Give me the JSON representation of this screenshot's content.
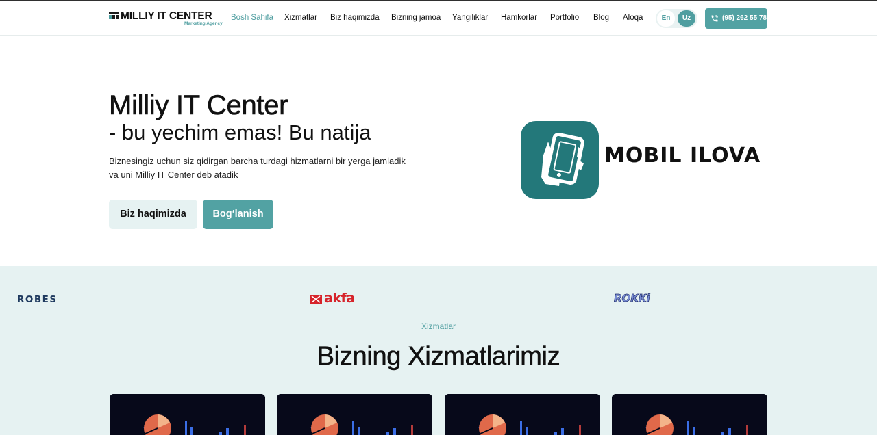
{
  "header": {
    "logo_text": "MILLIY IT CENTER",
    "logo_subtitle": "Marketing Agency",
    "nav": [
      {
        "label": "Bosh Sahifa",
        "active": true
      },
      {
        "label": "Xizmatlar"
      },
      {
        "label": "Biz haqimizda"
      },
      {
        "label": "Bizning jamoa"
      },
      {
        "label": "Yangiliklar"
      },
      {
        "label": "Hamkorlar"
      },
      {
        "label": "Portfolio"
      },
      {
        "label": "Blog"
      },
      {
        "label": "Aloqa"
      }
    ],
    "lang": {
      "en": "En",
      "uz": "Uz",
      "selected": "Uz"
    },
    "phone": "(95) 262 55 78"
  },
  "hero": {
    "title": "Milliy IT Center",
    "subtitle": "- bu yechim emas! Bu natija",
    "description_line1": "Biznesingiz uchun siz qidirgan barcha turdagi hizmatlarni bir yerga jamladik",
    "description_line2": "va uni Milliy IT Center deb atadik",
    "about_button": "Biz haqimizda",
    "contact_button": "Bog‘lanish",
    "banner_text": "MOBIL ILOVA"
  },
  "partners": [
    "ROBES",
    "akfa",
    "ROKKi"
  ],
  "services": {
    "kicker": "Xizmatlar",
    "title": "Bizning Xizmatlarimiz",
    "card_count": 4
  },
  "colors": {
    "accent": "#52a2a3",
    "accent_dark": "#23787a",
    "band_bg": "#e6f2f2",
    "text": "#111111",
    "akfa_red": "#d6242b"
  },
  "icons": [
    "phone-icon",
    "hand-phone-icon",
    "logo-mark-icon",
    "akfa-mark-icon"
  ]
}
